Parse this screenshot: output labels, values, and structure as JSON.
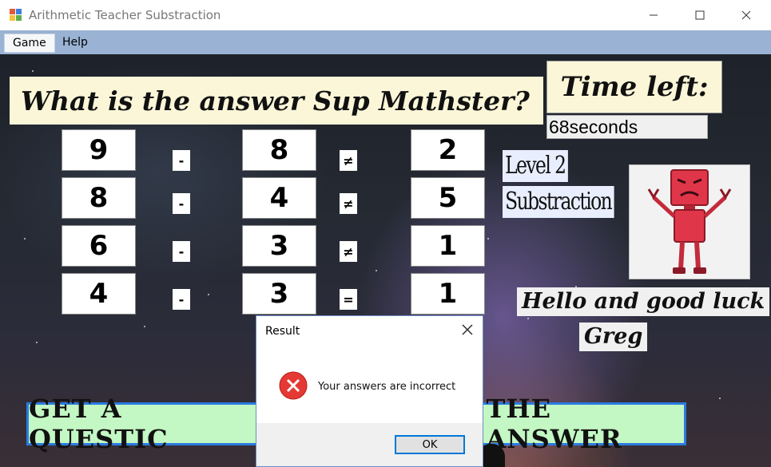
{
  "window": {
    "title": "Arithmetic Teacher Substraction",
    "minimize_icon": "minimize-icon",
    "maximize_icon": "maximize-icon",
    "close_icon": "close-icon"
  },
  "menu": {
    "items": [
      {
        "label": "Game"
      },
      {
        "label": "Help"
      }
    ]
  },
  "game": {
    "question": "What is the answer Sup Mathster?",
    "time_label": "Time left:",
    "time_value": "68seconds",
    "level_line1": "Level 2",
    "level_line2": "Substraction",
    "greeting_line1": "Hello and good luck",
    "greeting_name": "Greg",
    "get_question_label": "GET A QUESTIC",
    "check_answer_label": "THE ANSWER",
    "rows": [
      {
        "a": "9",
        "op": "-",
        "b": "8",
        "rel": "≠",
        "c": "2"
      },
      {
        "a": "8",
        "op": "-",
        "b": "4",
        "rel": "≠",
        "c": "5"
      },
      {
        "a": "6",
        "op": "-",
        "b": "3",
        "rel": "≠",
        "c": "1"
      },
      {
        "a": "4",
        "op": "-",
        "b": "3",
        "rel": "=",
        "c": "1"
      }
    ],
    "mascot": "angry-robot-icon"
  },
  "dialog": {
    "title": "Result",
    "message": "Your answers are incorrect",
    "ok_label": "OK",
    "icon": "error-icon",
    "colors": {
      "error": "#e53935",
      "accent": "#0078d7"
    }
  },
  "colors": {
    "menubar": "#9ab2d3",
    "banner": "#fbf6d8",
    "button_green": "#c3f7c3"
  }
}
